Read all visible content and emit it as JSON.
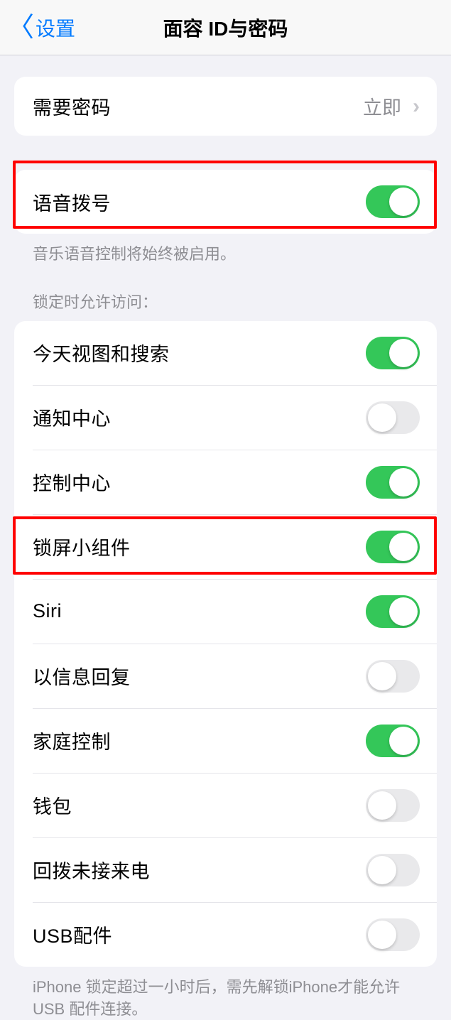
{
  "nav": {
    "back_label": "设置",
    "title": "面容 ID与密码"
  },
  "group1": {
    "require_passcode": {
      "label": "需要密码",
      "value": "立即"
    }
  },
  "group2": {
    "voice_dial": {
      "label": "语音拨号",
      "on": true
    },
    "footer": "音乐语音控制将始终被启用。"
  },
  "group3": {
    "header": "锁定时允许访问：",
    "items": [
      {
        "label": "今天视图和搜索",
        "on": true
      },
      {
        "label": "通知中心",
        "on": false
      },
      {
        "label": "控制中心",
        "on": true
      },
      {
        "label": "锁屏小组件",
        "on": true
      },
      {
        "label": "Siri",
        "on": true
      },
      {
        "label": "以信息回复",
        "on": false
      },
      {
        "label": "家庭控制",
        "on": true
      },
      {
        "label": "钱包",
        "on": false
      },
      {
        "label": "回拨未接来电",
        "on": false
      },
      {
        "label": "USB配件",
        "on": false
      }
    ],
    "footer": "iPhone 锁定超过一小时后，需先解锁iPhone才能允许USB 配件连接。"
  }
}
